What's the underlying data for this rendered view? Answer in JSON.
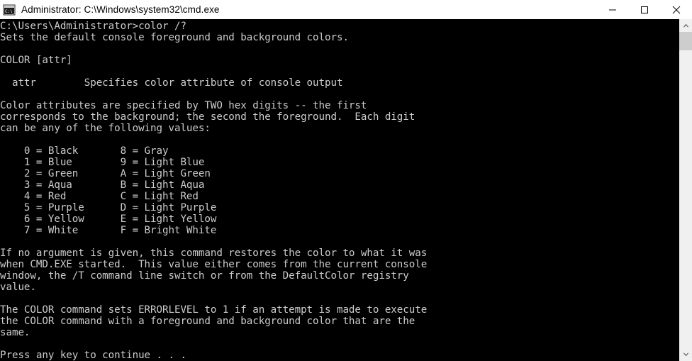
{
  "window": {
    "title": "Administrator: C:\\Windows\\system32\\cmd.exe",
    "icon": "cmd-console-icon",
    "background_color": "#000000",
    "titlebar_color": "#ffffff",
    "text_color": "#cccccc"
  },
  "controls": {
    "minimize_label": "Minimize",
    "maximize_label": "Maximize",
    "close_label": "Close"
  },
  "scrollbar": {
    "up_arrow": "scroll-up-arrow",
    "down_arrow": "scroll-down-arrow",
    "thumb": "scroll-thumb"
  },
  "console": {
    "content": "C:\\Users\\Administrator>color /?\nSets the default console foreground and background colors.\n\nCOLOR [attr]\n\n  attr        Specifies color attribute of console output\n\nColor attributes are specified by TWO hex digits -- the first\ncorresponds to the background; the second the foreground.  Each digit\ncan be any of the following values:\n\n    0 = Black       8 = Gray\n    1 = Blue        9 = Light Blue\n    2 = Green       A = Light Green\n    3 = Aqua        B = Light Aqua\n    4 = Red         C = Light Red\n    5 = Purple      D = Light Purple\n    6 = Yellow      E = Light Yellow\n    7 = White       F = Bright White\n\nIf no argument is given, this command restores the color to what it was\nwhen CMD.EXE started.  This value either comes from the current console\nwindow, the /T command line switch or from the DefaultColor registry\nvalue.\n\nThe COLOR command sets ERRORLEVEL to 1 if an attempt is made to execute\nthe COLOR command with a foreground and background color that are the\nsame.\n\nPress any key to continue . . .",
    "prompt": "C:\\Users\\Administrator>",
    "command": "color /?",
    "summary": "Sets the default console foreground and background colors.",
    "usage": "COLOR [attr]",
    "parameter_name": "attr",
    "parameter_description": "Specifies color attribute of console output",
    "color_table": [
      {
        "code": "0",
        "name": "Black",
        "code2": "8",
        "name2": "Gray"
      },
      {
        "code": "1",
        "name": "Blue",
        "code2": "9",
        "name2": "Light Blue"
      },
      {
        "code": "2",
        "name": "Green",
        "code2": "A",
        "name2": "Light Green"
      },
      {
        "code": "3",
        "name": "Aqua",
        "code2": "B",
        "name2": "Light Aqua"
      },
      {
        "code": "4",
        "name": "Red",
        "code2": "C",
        "name2": "Light Red"
      },
      {
        "code": "5",
        "name": "Purple",
        "code2": "D",
        "name2": "Light Purple"
      },
      {
        "code": "6",
        "name": "Yellow",
        "code2": "E",
        "name2": "Light Yellow"
      },
      {
        "code": "7",
        "name": "White",
        "code2": "F",
        "name2": "Bright White"
      }
    ],
    "continue_prompt": "Press any key to continue . . ."
  }
}
